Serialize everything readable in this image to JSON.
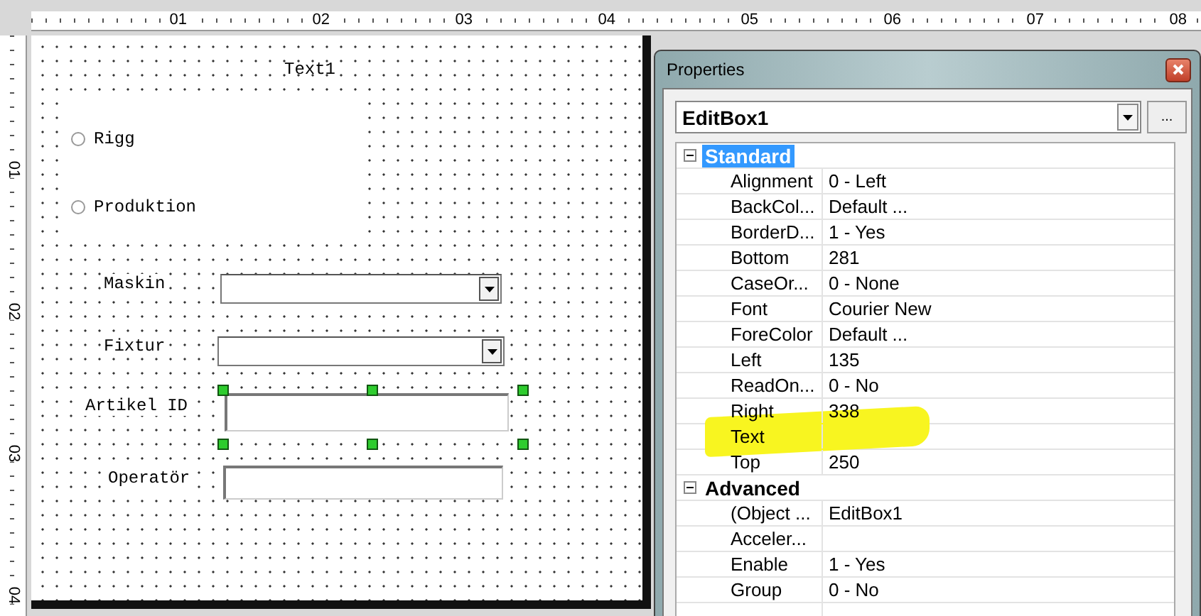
{
  "rulers": {
    "horizontal": [
      "01",
      "02",
      "03",
      "04",
      "05",
      "06",
      "07",
      "08"
    ],
    "vertical": [
      "01",
      "02",
      "03",
      "04"
    ]
  },
  "form": {
    "title_label": "Text1",
    "radios": [
      {
        "label": "Rigg",
        "selected": false
      },
      {
        "label": "Produktion",
        "selected": false
      }
    ],
    "fields": [
      {
        "kind": "combo",
        "label": "Maskin",
        "selected": false
      },
      {
        "kind": "combo",
        "label": "Fixtur",
        "selected": false
      },
      {
        "kind": "edit",
        "label": "Artikel ID",
        "selected": true
      },
      {
        "kind": "edit",
        "label": "Operatör",
        "selected": false
      }
    ]
  },
  "properties": {
    "title": "Properties",
    "object": "EditBox1",
    "more_button": "...",
    "groups": [
      {
        "name": "Standard",
        "expanded": true,
        "selected": true,
        "rows": [
          {
            "name": "Alignment",
            "value": "0 - Left",
            "highlighted": false
          },
          {
            "name": "BackCol...",
            "value": "Default ...",
            "highlighted": false
          },
          {
            "name": "BorderD...",
            "value": "1 - Yes",
            "highlighted": false
          },
          {
            "name": "Bottom",
            "value": "281",
            "highlighted": false
          },
          {
            "name": "CaseOr...",
            "value": "0 - None",
            "highlighted": false
          },
          {
            "name": "Font",
            "value": "Courier New",
            "highlighted": false
          },
          {
            "name": "ForeColor",
            "value": "Default ...",
            "highlighted": false
          },
          {
            "name": "Left",
            "value": "135",
            "highlighted": false
          },
          {
            "name": "ReadOn...",
            "value": "0 - No",
            "highlighted": false
          },
          {
            "name": "Right",
            "value": "338",
            "highlighted": false
          },
          {
            "name": "Text",
            "value": "",
            "highlighted": true
          },
          {
            "name": "Top",
            "value": "250",
            "highlighted": false
          }
        ]
      },
      {
        "name": "Advanced",
        "expanded": true,
        "selected": false,
        "rows": [
          {
            "name": "(Object ...",
            "value": "EditBox1",
            "highlighted": false
          },
          {
            "name": "Acceler...",
            "value": "",
            "highlighted": false
          },
          {
            "name": "Enable",
            "value": "1 - Yes",
            "highlighted": false
          },
          {
            "name": "Group",
            "value": "0 - No",
            "highlighted": false
          }
        ]
      }
    ]
  }
}
